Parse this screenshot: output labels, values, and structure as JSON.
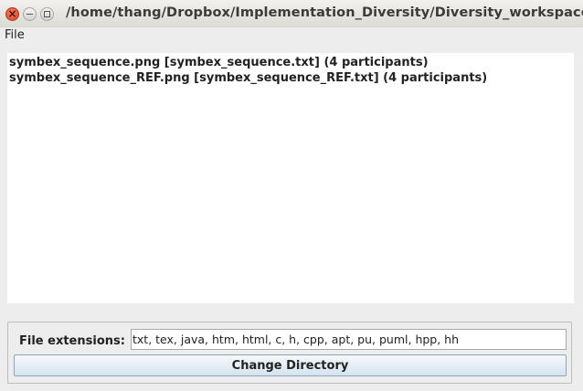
{
  "window": {
    "title": "/home/thang/Dropbox/Implementation_Diversity/Diversity_workspace/MPL_"
  },
  "menubar": {
    "items": [
      {
        "label": "File"
      }
    ]
  },
  "list": {
    "items": [
      {
        "label": "symbex_sequence.png [symbex_sequence.txt] (4 participants)"
      },
      {
        "label": "symbex_sequence_REF.png [symbex_sequence_REF.txt] (4 participants)"
      }
    ]
  },
  "controls": {
    "extensions_label": "File extensions:",
    "extensions_value": "txt, tex, java, htm, html, c, h, cpp, apt, pu, puml, hpp, hh",
    "change_directory_label": "Change Directory"
  }
}
